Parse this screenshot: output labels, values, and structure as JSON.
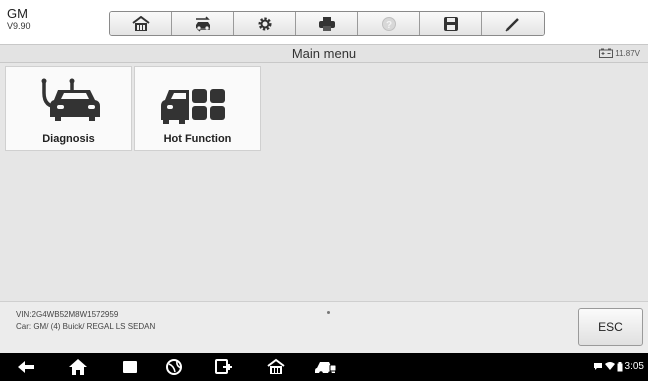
{
  "header": {
    "make": "GM",
    "version": "V9.90",
    "toolbar": [
      {
        "icon": "home-icon"
      },
      {
        "icon": "vehicle-swap-icon"
      },
      {
        "icon": "settings-icon"
      },
      {
        "icon": "print-icon"
      },
      {
        "icon": "help-icon",
        "disabled": true
      },
      {
        "icon": "save-icon"
      },
      {
        "icon": "pen-icon"
      }
    ]
  },
  "titlebar": {
    "title": "Main menu",
    "battery_voltage": "11.87V"
  },
  "menu": {
    "items": [
      {
        "label": "Diagnosis",
        "icon": "diagnosis-car-icon"
      },
      {
        "label": "Hot Function",
        "icon": "hot-function-icon"
      }
    ]
  },
  "vehicle": {
    "vin": "VIN:2G4WB52M8W1572959",
    "car": "Car: GM/ (4) Buick/ REGAL LS SEDAN"
  },
  "actions": {
    "esc_label": "ESC"
  },
  "system": {
    "time": "3:05",
    "nav_icons": [
      "back-icon",
      "home-icon",
      "recent-apps-icon",
      "browser-icon",
      "vci-connect-icon",
      "maxisys-home-icon",
      "vehicle-menu-icon"
    ]
  },
  "colors": {
    "content_bg": "#e6e6e6",
    "titlebar_bg": "#e3e3e3",
    "navbar_bg": "#000000"
  }
}
